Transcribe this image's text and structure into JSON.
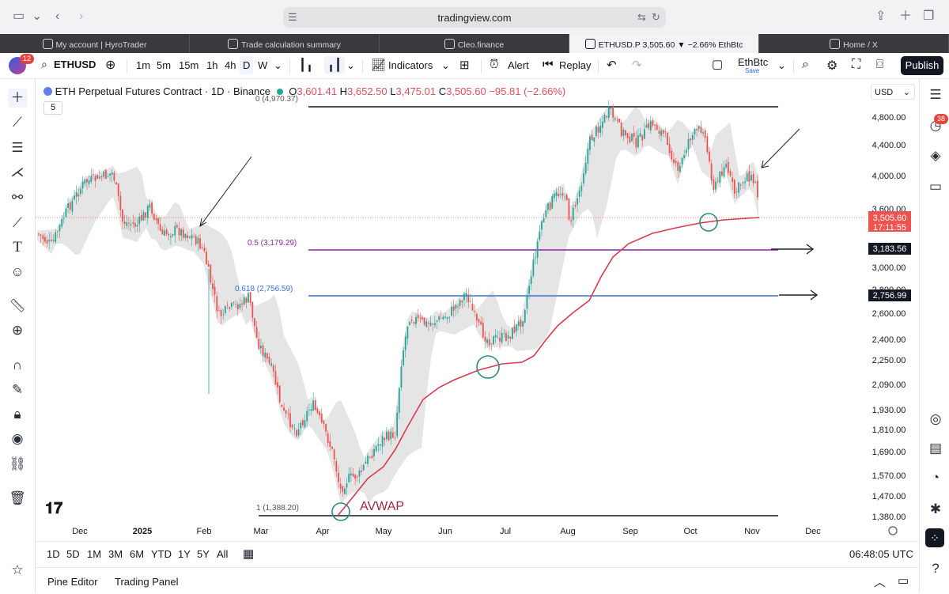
{
  "browser": {
    "url": "tradingview.com",
    "tabs": [
      {
        "label": "My account | HyroTrader",
        "active": false
      },
      {
        "label": "Trade calculation summary",
        "active": false
      },
      {
        "label": "Cleo.finance",
        "active": false
      },
      {
        "label": "ETHUSD.P 3,505.60 ▼ −2.66% EthBtc",
        "active": true
      },
      {
        "label": "Home / X",
        "active": false
      }
    ]
  },
  "toolbar": {
    "avatar_badge": "12",
    "symbol": "ETHUSD",
    "intervals": [
      "1m",
      "5m",
      "15m",
      "1h",
      "4h",
      "D",
      "W"
    ],
    "active_interval": "D",
    "indicators_label": "Indicators",
    "alert_label": "Alert",
    "replay_label": "Replay",
    "layout_name": "EthBtc",
    "layout_save": "Save",
    "publish_label": "Publish"
  },
  "legend": {
    "title": "ETH Perpetual Futures Contract · 1D · Binance",
    "o_label": "O",
    "o_value": "3,601.41",
    "h_label": "H",
    "h_value": "3,652.50",
    "l_label": "L",
    "l_value": "3,475.01",
    "c_label": "C",
    "c_value": "3,505.60",
    "change": "−95.81 (−2.66%)",
    "indicator_count": "5"
  },
  "currency": "USD",
  "fib_labels": {
    "level0": "0 (4,970.37)",
    "level05": "0.5 (3,179.29)",
    "level0618": "0.618 (2,756.59)",
    "level1": "1 (1,388.20)"
  },
  "avwap_label": "AVWAP",
  "price_axis": [
    "4,800.00",
    "4,400.00",
    "4,000.00",
    "3,600.00",
    "3,000.00",
    "2,800.00",
    "2,600.00",
    "2,400.00",
    "2,250.00",
    "2,090.00",
    "1,930.00",
    "1,810.00",
    "1,690.00",
    "1,570.00",
    "1,470.00",
    "1,380.00"
  ],
  "price_tags": {
    "last_price": "3,505.60",
    "countdown": "17:11:55",
    "fib05": "3,183.56",
    "fib0618": "2,756.99"
  },
  "time_axis": [
    "Dec",
    "2025",
    "Feb",
    "Mar",
    "Apr",
    "May",
    "Jun",
    "Jul",
    "Aug",
    "Sep",
    "Oct",
    "Nov",
    "Dec"
  ],
  "ranges": [
    "1D",
    "5D",
    "1M",
    "3M",
    "6M",
    "YTD",
    "1Y",
    "5Y",
    "All"
  ],
  "clock": "06:48:05 UTC",
  "bottom": {
    "pine_editor": "Pine Editor",
    "trading_panel": "Trading Panel"
  },
  "right_badge": "38",
  "colors": {
    "up": "#26a69a",
    "down": "#ef5350",
    "avwap": "#d63b4e",
    "fib05": "#8e24aa",
    "fib0618": "#3f6fd8",
    "band": "#e1e1e1"
  }
}
